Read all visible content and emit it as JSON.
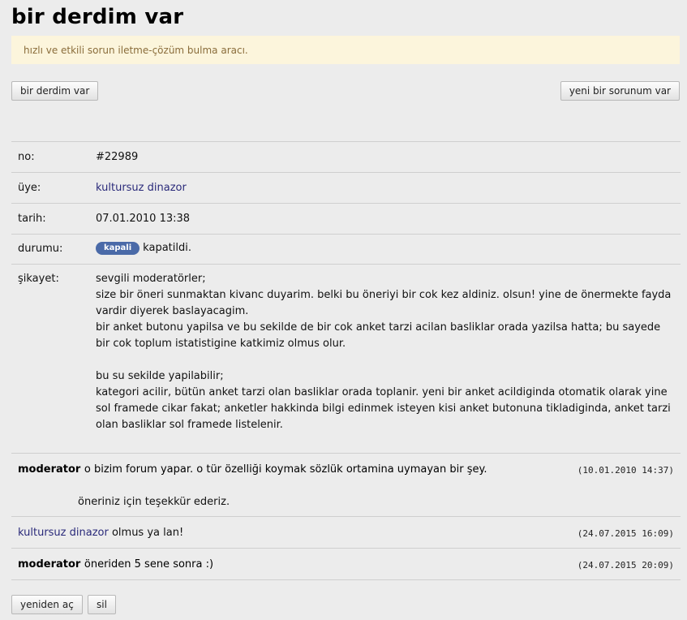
{
  "page": {
    "title": "bir derdim var",
    "notice": "hızlı ve etkili sorun iletme-çözüm bulma aracı."
  },
  "buttons": {
    "left": "bir derdim var",
    "right": "yeni bir sorunum var",
    "reopen": "yeniden aç",
    "delete": "sil"
  },
  "details": {
    "no_label": "no:",
    "no_value": "#22989",
    "user_label": "üye:",
    "user_value": "kultursuz dinazor",
    "date_label": "tarih:",
    "date_value": "07.01.2010 13:38",
    "status_label": "durumu:",
    "status_badge": "kapali",
    "status_text": "kapatildi.",
    "complaint_label": "şikayet:",
    "complaint_lines": [
      "sevgili moderatörler;",
      "size bir öneri sunmaktan kivanc duyarim. belki bu öneriyi bir cok kez aldiniz. olsun! yine de önermekte fayda vardir diyerek baslayacagim.",
      "bir anket butonu yapilsa ve bu sekilde de bir cok anket tarzi acilan basliklar orada yazilsa hatta; bu sayede bir cok toplum istatistigine katkimiz olmus olur.",
      "",
      "bu su sekilde yapilabilir;",
      "kategori acilir, bütün anket tarzi olan basliklar orada toplanir. yeni bir anket acildiginda otomatik olarak yine sol framede cikar fakat; anketler hakkinda bilgi edinmek isteyen kisi anket butonuna tikladiginda, anket tarzi olan basliklar sol framede listelenir."
    ]
  },
  "comments": [
    {
      "author": "moderator",
      "text": "o bizim forum yapar. o tür özelliği koymak sözlük ortamina uymayan bir şey.",
      "extra": "öneriniz için teşekkür ederiz.",
      "time": "(10.01.2010 14:37)"
    },
    {
      "author": "kultursuz dinazor",
      "text": "olmus ya lan!",
      "time": "(24.07.2015 16:09)"
    },
    {
      "author": "moderator",
      "text": "öneriden 5 sene sonra :)",
      "time": "(24.07.2015 20:09)"
    }
  ]
}
